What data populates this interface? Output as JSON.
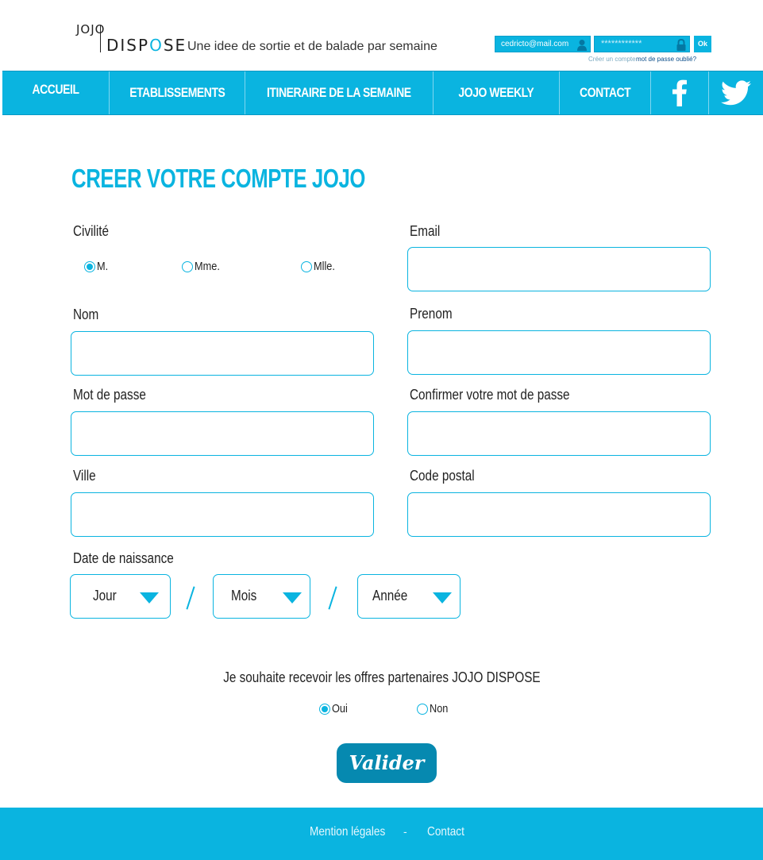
{
  "header": {
    "logo_top": "JOJO",
    "logo_main_a": "DISP",
    "logo_main_o": "O",
    "logo_main_b": "SE",
    "tagline": "Une idee de sortie et de balade par semaine",
    "login": {
      "email_value": "cedricto@mail.com",
      "password_value": "************",
      "ok_label": "Ok",
      "create_account": "Créer un compte",
      "forgot_password": "mot de passe oublié?"
    }
  },
  "nav": {
    "items": [
      {
        "label": "ACCUEIL"
      },
      {
        "label": "ETABLISSEMENTS"
      },
      {
        "label": "ITINERAIRE DE LA SEMAINE"
      },
      {
        "label": "JOJO WEEKLY"
      },
      {
        "label": "CONTACT"
      }
    ]
  },
  "form": {
    "title": "CREER VOTRE COMPTE JOJO",
    "civility_label": "Civilité",
    "civility_options": [
      {
        "label": "M.",
        "selected": true
      },
      {
        "label": "Mme.",
        "selected": false
      },
      {
        "label": "Mlle.",
        "selected": false
      }
    ],
    "email_label": "Email",
    "nom_label": "Nom",
    "prenom_label": "Prenom",
    "password_label": "Mot de passe",
    "confirm_password_label": "Confirmer votre mot de passe",
    "ville_label": "Ville",
    "code_postal_label": "Code postal",
    "birthdate_label": "Date de naissance",
    "day_select": "Jour",
    "month_select": "Mois",
    "year_select": "Année",
    "offers_question": "Je souhaite recevoir les offres partenaires JOJO DISPOSE",
    "offers_options": [
      {
        "label": "Oui",
        "selected": true
      },
      {
        "label": "Non",
        "selected": false
      }
    ],
    "submit_label": "Valider"
  },
  "footer": {
    "legal_link": "Mention légales",
    "separator": "-",
    "contact_link": "Contact"
  },
  "colors": {
    "accent": "#0ab4e0",
    "button": "#0689b0"
  }
}
